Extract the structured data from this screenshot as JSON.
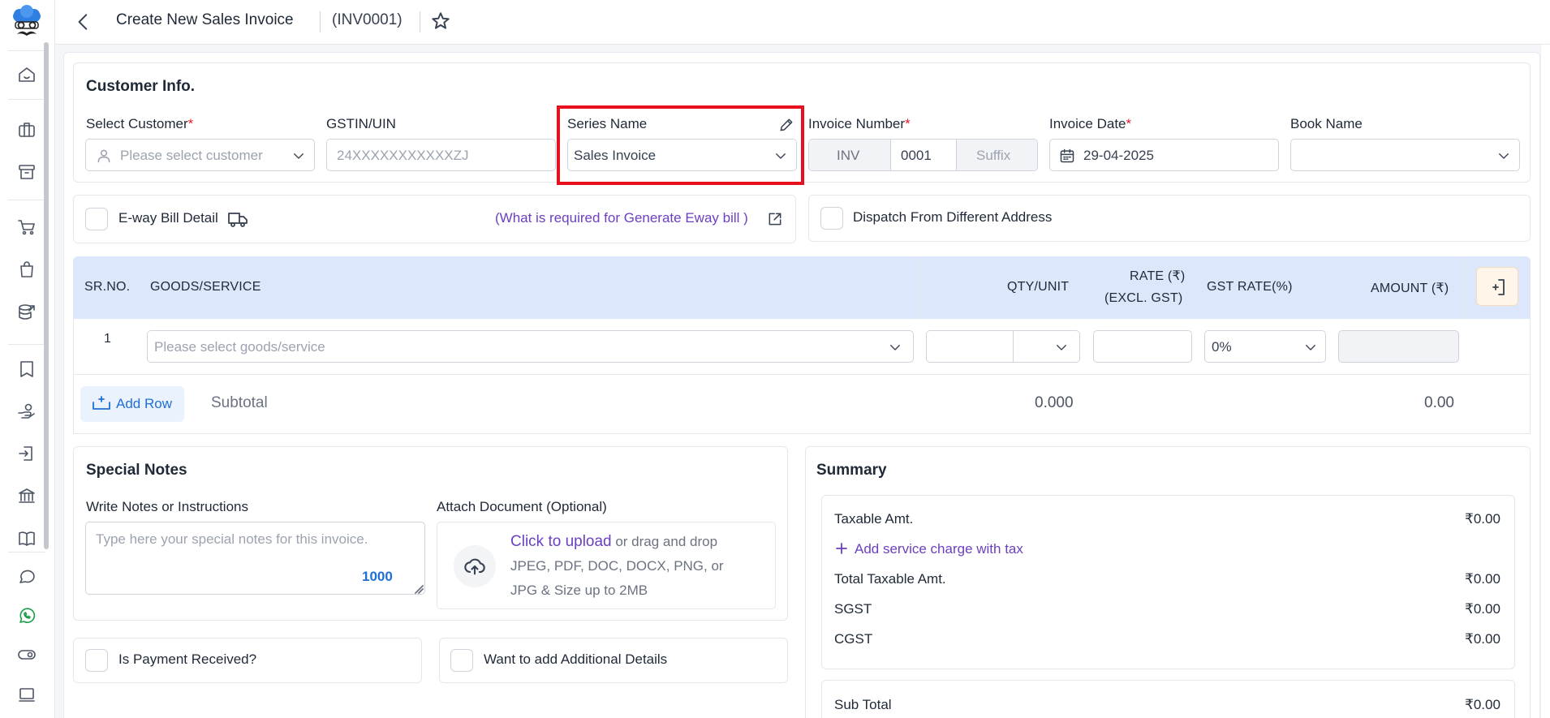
{
  "header": {
    "title": "Create New Sales Invoice",
    "invoice_code": "(INV0001)"
  },
  "customer_info": {
    "heading": "Customer Info.",
    "select_customer_label": "Select Customer",
    "select_customer_placeholder": "Please select customer",
    "gstin_label": "GSTIN/UIN",
    "gstin_placeholder": "24XXXXXXXXXXXZJ",
    "series_name_label": "Series Name",
    "series_name_value": "Sales Invoice",
    "invoice_number_label": "Invoice Number",
    "invoice_prefix": "INV",
    "invoice_number": "0001",
    "invoice_suffix_placeholder": "Suffix",
    "invoice_date_label": "Invoice Date",
    "invoice_date_value": "29-04-2025",
    "book_name_label": "Book Name",
    "required_mark": "*"
  },
  "eway": {
    "label": "E-way Bill Detail",
    "link": "(What is required for Generate Eway bill )"
  },
  "dispatch": {
    "label": "Dispatch From Different Address"
  },
  "table": {
    "headers": {
      "sr_no": "SR.NO.",
      "goods": "GOODS/SERVICE",
      "qty": "QTY/UNIT",
      "rate_line1": "RATE (₹)",
      "rate_line2": "(EXCL. GST)",
      "gst": "GST RATE(%)",
      "amount": "AMOUNT (₹)"
    },
    "rows": [
      {
        "sr": "1",
        "goods_placeholder": "Please select goods/service",
        "gst": "0%"
      }
    ],
    "add_row": "Add Row",
    "subtotal_label": "Subtotal",
    "subtotal_qty": "0.000",
    "subtotal_amount": "0.00"
  },
  "notes": {
    "heading": "Special Notes",
    "write_label": "Write Notes or Instructions",
    "placeholder": "Type here your special notes for this invoice.",
    "char_count": "1000",
    "attach_label": "Attach Document (Optional)",
    "upload_link": "Click to upload",
    "upload_text": " or drag and drop",
    "upload_hint_1": "JPEG, PDF, DOC, DOCX, PNG, or",
    "upload_hint_2": "JPG & Size up to 2MB"
  },
  "payment": {
    "label": "Is Payment Received?"
  },
  "additional": {
    "label": "Want to add Additional Details"
  },
  "summary": {
    "heading": "Summary",
    "taxable_label": "Taxable Amt.",
    "taxable_value": "₹0.00",
    "service_charge_link": "Add service charge with tax",
    "total_taxable_label": "Total Taxable Amt.",
    "total_taxable_value": "₹0.00",
    "sgst_label": "SGST",
    "sgst_value": "₹0.00",
    "cgst_label": "CGST",
    "cgst_value": "₹0.00",
    "subtotal_label": "Sub Total",
    "subtotal_value": "₹0.00"
  },
  "colors": {
    "accent_purple": "#6b3fbf",
    "accent_blue": "#1e6fd6",
    "highlight_red": "#e8101e",
    "table_header_bg": "#dde7fb",
    "whatsapp_green": "#1a9e4b"
  }
}
